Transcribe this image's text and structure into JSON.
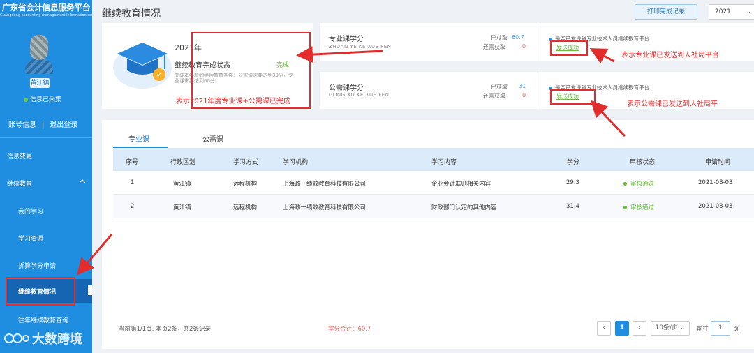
{
  "app": {
    "title": "广东省会计信息服务平台",
    "subtitle": "Guangdong accounting management information service platform",
    "user_name": "黄江镇",
    "collected_status": "信息已采集",
    "account_info": "账号信息",
    "separator": "|",
    "logout": "退出登录"
  },
  "nav": {
    "info_change": "信息变更",
    "continuing_edu": "继续教育",
    "collapse_icon": "chevron-up-icon",
    "my_study": "我的学习",
    "resources": "学习资源",
    "credit_apply": "折算学分申请",
    "edu_status": "继续教育情况",
    "history": "往年继续教育查询"
  },
  "header": {
    "page_title": "继续教育情况",
    "print_label": "打印完成记录",
    "year": "2021"
  },
  "summary": {
    "year": "2021年",
    "status_label": "继续教育完成状态",
    "status_value": "完成",
    "condition_text": "完成本年度的继续教育条件：公需课需要达到30分，专业课需要达到60分"
  },
  "professional": {
    "title": "专业课学分",
    "pinyin": "ZHUAN YE KE XUE FEN",
    "earned_label": "已获取",
    "earned": "60.7",
    "remaining_label": "还需获取",
    "remaining": "0",
    "sent_question": "是否已发送省专业技术人员继续教育平台",
    "sent_status": "发送成功"
  },
  "public": {
    "title": "公需课学分",
    "pinyin": "GONG XU KE XUE FEN",
    "earned_label": "已获取",
    "earned": "31",
    "remaining_label": "还需获取",
    "remaining": "0",
    "sent_question": "是否已发送省专业技术人员继续教育平台",
    "sent_status": "发送成功"
  },
  "annotations": {
    "note_completion": "表示2021年度专业课+公需课已完成",
    "note_professional": "表示专业课已发送到人社局平台",
    "note_public": "表示公需课已发送到人社局平"
  },
  "tabs": [
    "专业课",
    "公需课"
  ],
  "table": {
    "headers": [
      "序号",
      "行政区划",
      "学习方式",
      "学习机构",
      "学习内容",
      "学分",
      "审核状态",
      "申请时间"
    ],
    "rows": [
      {
        "no": "1",
        "region": "黄江镇",
        "mode": "远程机构",
        "org": "上海政一绩效教育科技有限公司",
        "content": "企业会计准则相关内容",
        "credit": "29.3",
        "status": "审核通过",
        "date": "2021-08-03"
      },
      {
        "no": "2",
        "region": "黄江镇",
        "mode": "远程机构",
        "org": "上海政一绩效教育科技有限公司",
        "content": "财政部门认定的其他内容",
        "credit": "31.4",
        "status": "审核通过",
        "date": "2021-08-03"
      }
    ]
  },
  "footer": {
    "page_info": "当前第1/1页, 本页2条，共2条记录",
    "total": "学分合计：60.7",
    "prev": "‹",
    "current": "1",
    "next": "›",
    "page_size": "10条/页",
    "goto_label": "前往",
    "goto_value": "1",
    "page_suffix": "页"
  },
  "watermark": "大数跨境",
  "colors": {
    "sidebar": "#1f8ee0",
    "accent": "#1f8ee0",
    "success": "#67c23a",
    "danger": "#f56c6c",
    "annotation": "#e32d2d"
  }
}
